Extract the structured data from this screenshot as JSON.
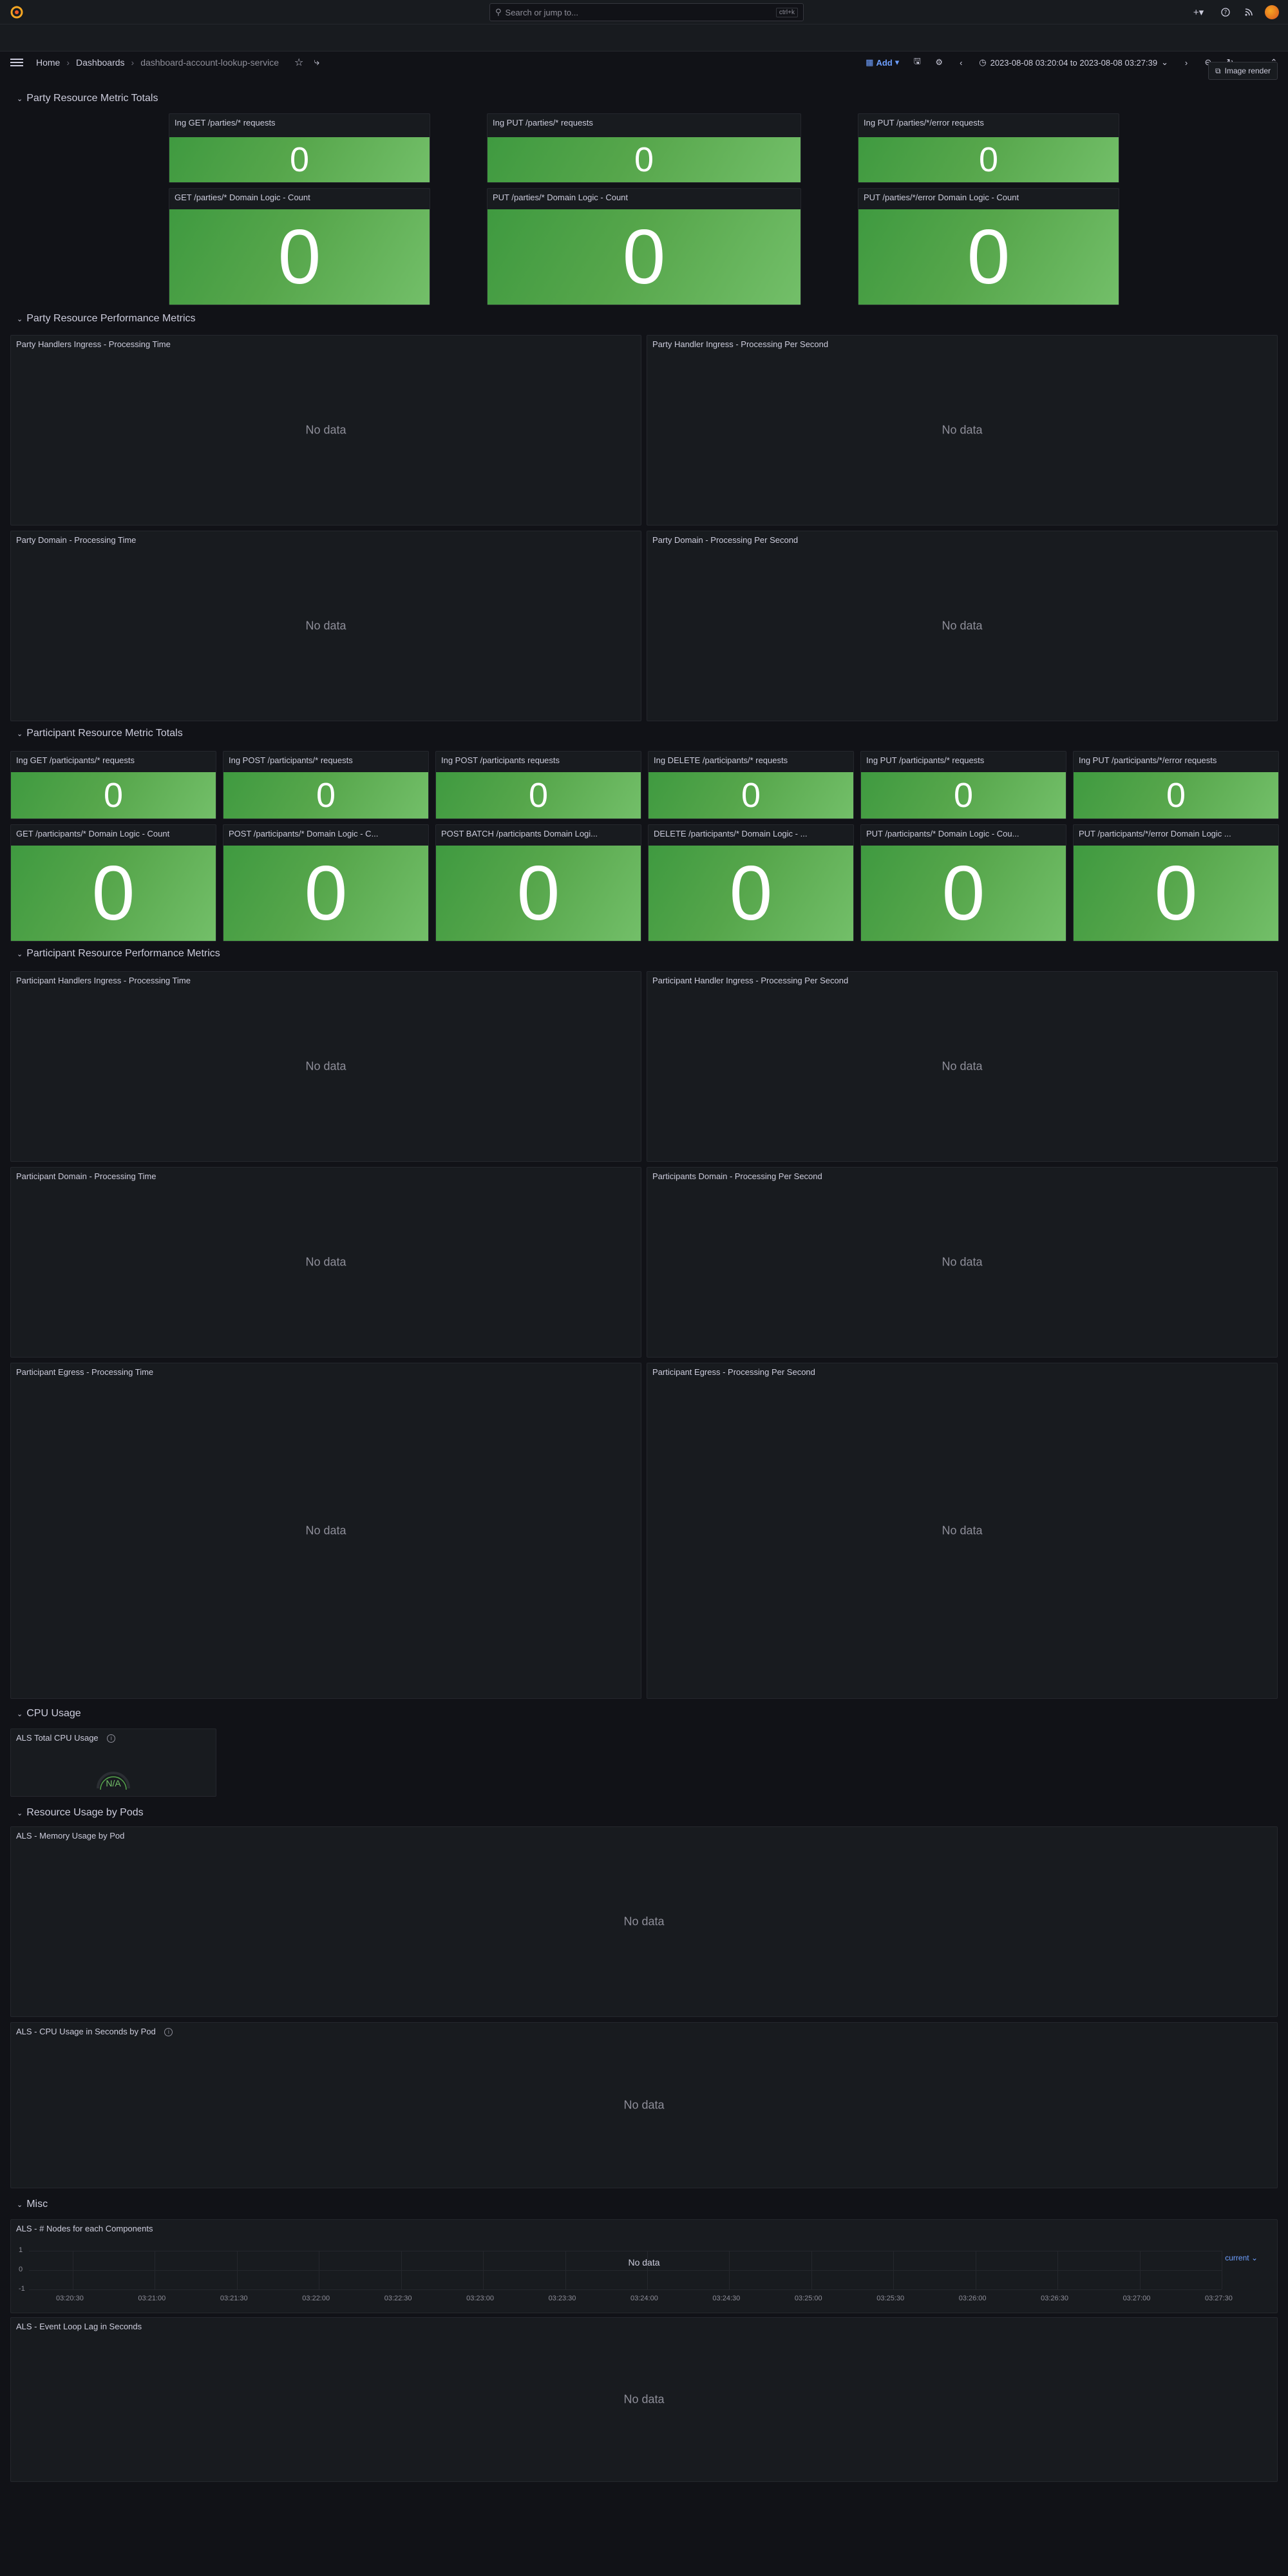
{
  "topbar": {
    "search_placeholder": "Search or jump to...",
    "search_shortcut": "ctrl+k",
    "icons": [
      "plus-icon",
      "help-icon",
      "news-icon",
      "avatar"
    ]
  },
  "navbar": {
    "breadcrumbs": [
      "Home",
      "Dashboards",
      "dashboard-account-lookup-service"
    ],
    "add_label": "Add",
    "time_range": "2023-08-08 03:20:04 to 2023-08-08 03:27:39"
  },
  "image_render_label": "Image render",
  "no_data": "No data",
  "rows": {
    "party_totals": "Party Resource Metric Totals",
    "party_perf": "Party Resource Performance Metrics",
    "participant_totals": "Participant Resource Metric Totals",
    "participant_perf": "Participant Resource Performance Metrics",
    "cpu": "CPU Usage",
    "pods": "Resource Usage by Pods",
    "misc": "Misc"
  },
  "party_stats": {
    "ingress": [
      {
        "title": "Ing GET /parties/* requests",
        "value": "0"
      },
      {
        "title": "Ing PUT /parties/* requests",
        "value": "0"
      },
      {
        "title": "Ing PUT /parties/*/error requests",
        "value": "0"
      }
    ],
    "domain": [
      {
        "title": "GET /parties/* Domain Logic - Count",
        "value": "0"
      },
      {
        "title": "PUT /parties/* Domain Logic - Count",
        "value": "0"
      },
      {
        "title": "PUT /parties/*/error Domain Logic - Count",
        "value": "0"
      }
    ]
  },
  "party_perf_panels": [
    "Party Handlers Ingress - Processing Time",
    "Party Handler Ingress - Processing Per Second",
    "Party Domain - Processing Time",
    "Party Domain - Processing Per Second"
  ],
  "participant_stats": {
    "ingress": [
      {
        "title": "Ing GET /participants/* requests",
        "value": "0"
      },
      {
        "title": "Ing POST /participants/* requests",
        "value": "0"
      },
      {
        "title": "Ing POST /participants requests",
        "value": "0"
      },
      {
        "title": "Ing DELETE /participants/* requests",
        "value": "0"
      },
      {
        "title": "Ing PUT /participants/* requests",
        "value": "0"
      },
      {
        "title": "Ing PUT /participants/*/error requests",
        "value": "0"
      }
    ],
    "domain": [
      {
        "title": "GET /participants/* Domain Logic - Count",
        "value": "0"
      },
      {
        "title": "POST /participants/* Domain Logic - C...",
        "value": "0"
      },
      {
        "title": "POST BATCH /participants Domain Logi...",
        "value": "0"
      },
      {
        "title": "DELETE /participants/* Domain Logic - ...",
        "value": "0"
      },
      {
        "title": "PUT /participants/* Domain Logic - Cou...",
        "value": "0"
      },
      {
        "title": "PUT /participants/*/error Domain Logic ...",
        "value": "0"
      }
    ]
  },
  "participant_perf_panels": [
    "Participant Handlers Ingress - Processing Time",
    "Participant Handler Ingress - Processing Per Second",
    "Participant Domain - Processing Time",
    "Participants Domain - Processing Per Second",
    "Participant Egress - Processing Time",
    "Participant Egress - Processing Per Second"
  ],
  "cpu_panel": {
    "title": "ALS Total CPU Usage",
    "value": "N/A"
  },
  "pod_panels": [
    "ALS - Memory Usage by Pod",
    "ALS - CPU Usage in Seconds by Pod"
  ],
  "misc_panels": {
    "nodes": {
      "title": "ALS - # Nodes for each Components",
      "legend": "current",
      "y_ticks": [
        "1",
        "0",
        "-1"
      ],
      "x_ticks": [
        "03:20:30",
        "03:21:00",
        "03:21:30",
        "03:22:00",
        "03:22:30",
        "03:23:00",
        "03:23:30",
        "03:24:00",
        "03:24:30",
        "03:25:00",
        "03:25:30",
        "03:26:00",
        "03:26:30",
        "03:27:00",
        "03:27:30"
      ]
    },
    "event_loop": {
      "title": "ALS - Event Loop Lag in Seconds"
    }
  }
}
